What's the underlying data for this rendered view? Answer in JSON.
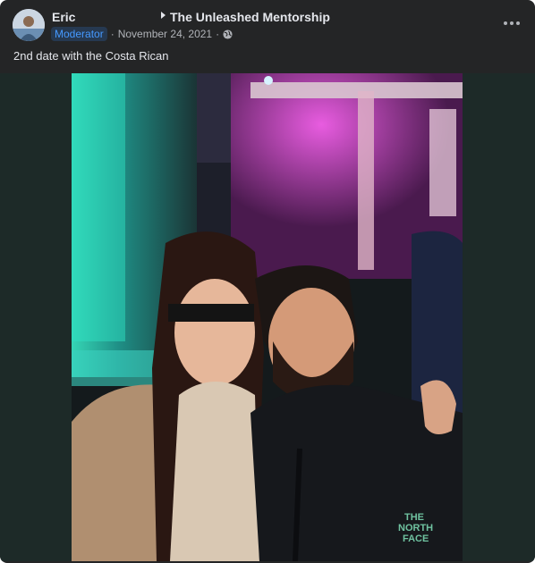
{
  "post": {
    "author": "Eric",
    "role_badge": "Moderator",
    "date": "November 24, 2021",
    "separator": "·",
    "privacy_icon": "globe-icon",
    "group": "The Unleashed Mentorship",
    "caption": "2nd date with the Costa Rican",
    "more_icon": "more-horizontal-icon",
    "photo_subject": "selfie-photo"
  },
  "colors": {
    "card_bg": "#242526",
    "text_primary": "#e4e6eb",
    "text_secondary": "#b0b3b8",
    "badge_bg": "#263951",
    "badge_text": "#4599ff"
  }
}
